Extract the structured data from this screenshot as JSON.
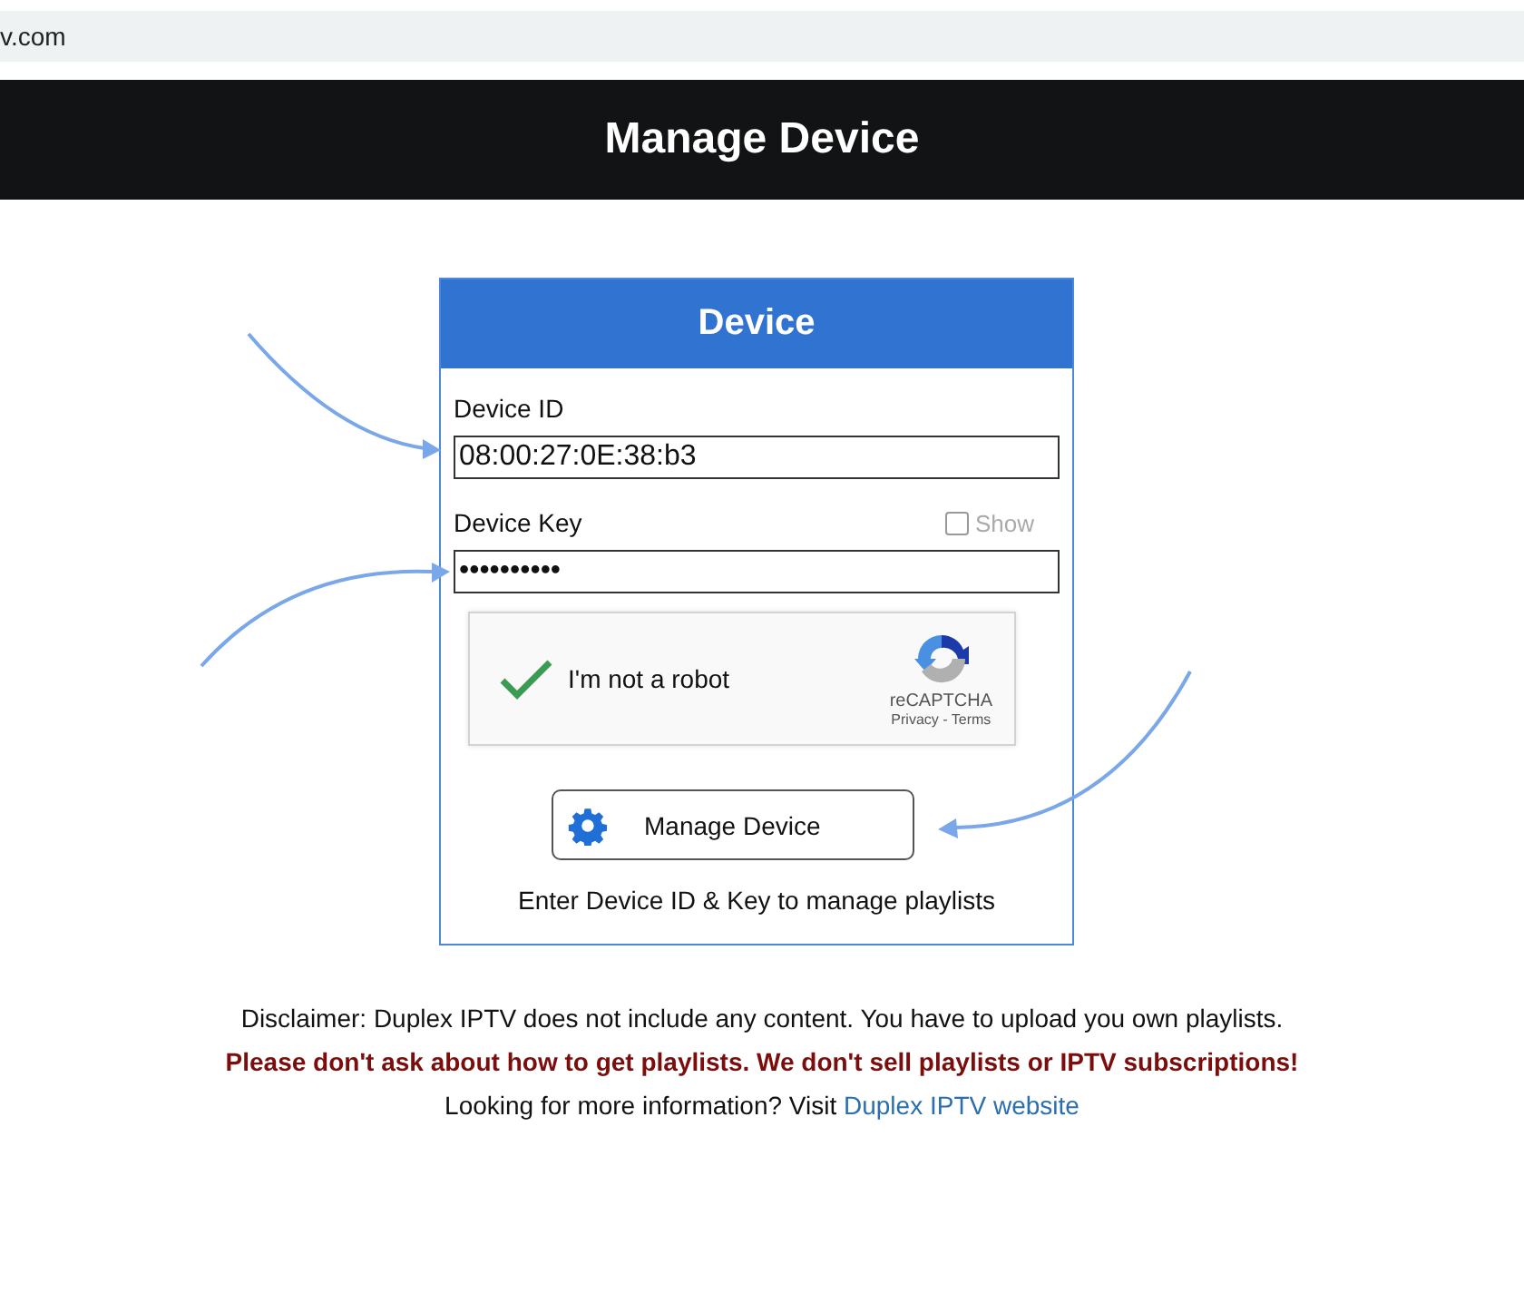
{
  "address_bar": {
    "url": "v.com"
  },
  "header": {
    "title": "Manage Device"
  },
  "card": {
    "title": "Device",
    "fields": [
      {
        "label": "Device ID",
        "value": "08:00:27:0E:38:b3"
      },
      {
        "label": "Device Key",
        "value": "••••••••••",
        "show": {
          "label": "Show",
          "checked": false
        }
      }
    ],
    "captcha": {
      "label": "I'm not a robot",
      "checked": true,
      "brand": "reCAPTCHA",
      "links": "Privacy - Terms"
    },
    "button": "Manage Device",
    "hint": "Enter Device ID & Key to manage playlists"
  },
  "footer": {
    "disclaimer": "Disclaimer: Duplex IPTV does not include any content. You have to upload you own playlists.",
    "warning": "Please don't ask about how to get playlists. We don't sell playlists or IPTV subscriptions!",
    "info": "Looking for more information? Visit",
    "link": "Duplex IPTV website"
  }
}
